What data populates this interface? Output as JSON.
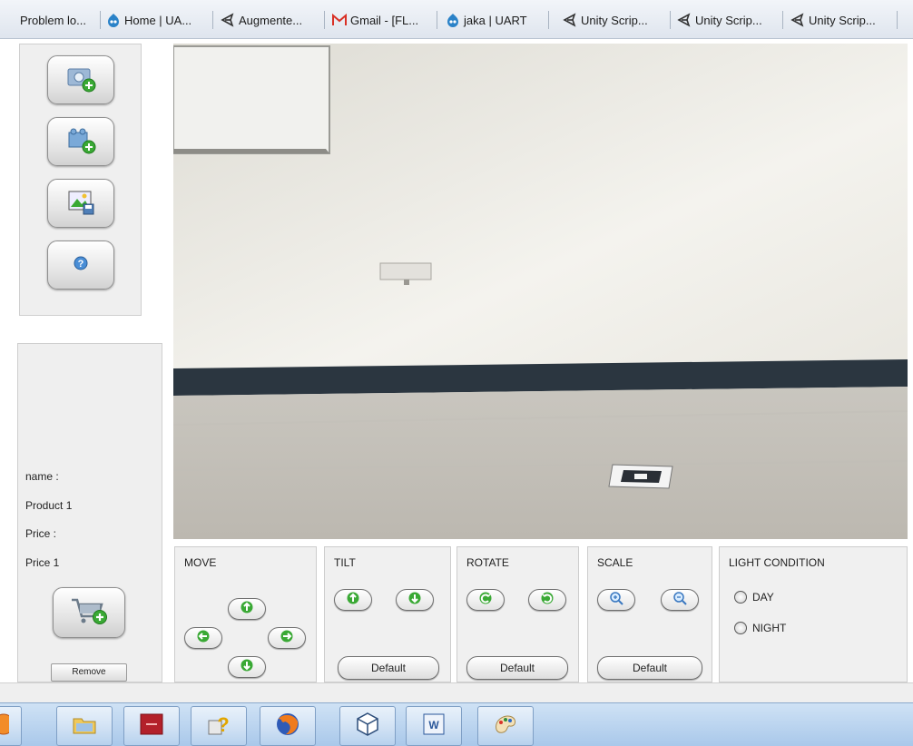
{
  "tabs": [
    {
      "label": "Problem lo...",
      "icon": "document-icon"
    },
    {
      "label": "Home | UA...",
      "icon": "drupal-icon"
    },
    {
      "label": "Augmente...",
      "icon": "unity-icon"
    },
    {
      "label": "Gmail - [FL...",
      "icon": "gmail-icon"
    },
    {
      "label": "jaka | UART",
      "icon": "drupal-icon"
    },
    {
      "label": "Unity Scrip...",
      "icon": "unity-icon"
    },
    {
      "label": "Unity Scrip...",
      "icon": "unity-icon"
    },
    {
      "label": "Unity Scrip...",
      "icon": "unity-icon"
    }
  ],
  "toolbar": {
    "buttons": [
      "add-photo-icon",
      "add-object-icon",
      "save-image-icon",
      "help-icon"
    ]
  },
  "product": {
    "name_label": "name :",
    "name_value": "Product 1",
    "price_label": "Price :",
    "price_value": "Price 1",
    "cart_icon": "add-to-cart-icon",
    "remove_label": "Remove"
  },
  "controls": {
    "move": {
      "title": "MOVE"
    },
    "tilt": {
      "title": "TILT",
      "default_label": "Default"
    },
    "rotate": {
      "title": "ROTATE",
      "default_label": "Default"
    },
    "scale": {
      "title": "SCALE",
      "default_label": "Default"
    },
    "light": {
      "title": "LIGHT CONDITION",
      "day_label": "DAY",
      "night_label": "NIGHT"
    }
  },
  "taskbar": {
    "apps": [
      "file-explorer-icon",
      "app-red-icon",
      "help-question-icon",
      "firefox-icon",
      "unity-cube-icon",
      "word-icon",
      "paint-icon"
    ]
  },
  "colors": {
    "accent_green": "#3aa935",
    "taskbar_blue": "#a9c8ea",
    "wall_stripe": "#2b3640"
  }
}
